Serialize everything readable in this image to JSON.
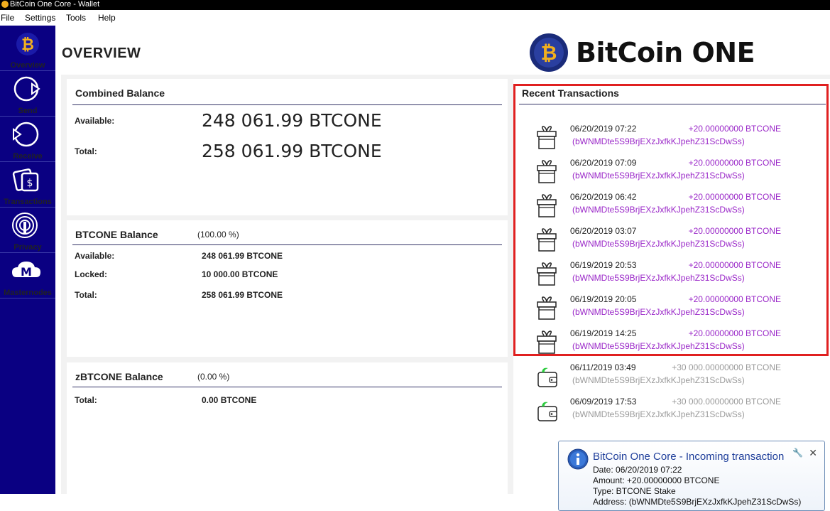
{
  "window": {
    "title": "BitCoin One Core - Wallet"
  },
  "menu": [
    "File",
    "Settings",
    "Tools",
    "Help"
  ],
  "nav": [
    {
      "label": "Overview",
      "icon": "bitcoin-one-logo-icon"
    },
    {
      "label": "Send",
      "icon": "send-icon"
    },
    {
      "label": "Receive",
      "icon": "receive-icon"
    },
    {
      "label": "Transactions",
      "icon": "transactions-icon"
    },
    {
      "label": "Privacy",
      "icon": "privacy-icon"
    },
    {
      "label": "Masternodes",
      "icon": "masternodes-icon"
    }
  ],
  "page": {
    "title": "OVERVIEW",
    "brand": "BitCoin ONE"
  },
  "combined": {
    "title": "Combined Balance",
    "available_label": "Available:",
    "available": "248 061.99 BTCONE",
    "total_label": "Total:",
    "total": "258 061.99 BTCONE"
  },
  "btcone": {
    "title": "BTCONE Balance",
    "pct": "(100.00 %)",
    "available_label": "Available:",
    "available": "248 061.99 BTCONE",
    "locked_label": "Locked:",
    "locked": "10 000.00 BTCONE",
    "total_label": "Total:",
    "total": "258 061.99 BTCONE"
  },
  "zbtcone": {
    "title": "zBTCONE Balance",
    "pct": "(0.00 %)",
    "total_label": "Total:",
    "total": "0.00 BTCONE"
  },
  "recent": {
    "title": "Recent Transactions",
    "items": [
      {
        "date": "06/20/2019 07:22",
        "amount": "+20.00000000 BTCONE",
        "address": "(bWNMDte5S9BrjEXzJxfkKJpehZ31ScDwSs)",
        "icon": "gift-icon"
      },
      {
        "date": "06/20/2019 07:09",
        "amount": "+20.00000000 BTCONE",
        "address": "(bWNMDte5S9BrjEXzJxfkKJpehZ31ScDwSs)",
        "icon": "gift-icon"
      },
      {
        "date": "06/20/2019 06:42",
        "amount": "+20.00000000 BTCONE",
        "address": "(bWNMDte5S9BrjEXzJxfkKJpehZ31ScDwSs)",
        "icon": "gift-icon"
      },
      {
        "date": "06/20/2019 03:07",
        "amount": "+20.00000000 BTCONE",
        "address": "(bWNMDte5S9BrjEXzJxfkKJpehZ31ScDwSs)",
        "icon": "gift-icon"
      },
      {
        "date": "06/19/2019 20:53",
        "amount": "+20.00000000 BTCONE",
        "address": "(bWNMDte5S9BrjEXzJxfkKJpehZ31ScDwSs)",
        "icon": "gift-icon"
      },
      {
        "date": "06/19/2019 20:05",
        "amount": "+20.00000000 BTCONE",
        "address": "(bWNMDte5S9BrjEXzJxfkKJpehZ31ScDwSs)",
        "icon": "gift-icon"
      },
      {
        "date": "06/19/2019 14:25",
        "amount": "+20.00000000 BTCONE",
        "address": "(bWNMDte5S9BrjEXzJxfkKJpehZ31ScDwSs)",
        "icon": "gift-icon"
      },
      {
        "date": "06/11/2019 03:49",
        "amount": "+30 000.00000000 BTCONE",
        "address": "(bWNMDte5S9BrjEXzJxfkKJpehZ31ScDwSs)",
        "icon": "wallet-icon"
      },
      {
        "date": "06/09/2019 17:53",
        "amount": "+30 000.00000000 BTCONE",
        "address": "(bWNMDte5S9BrjEXzJxfkKJpehZ31ScDwSs)",
        "icon": "wallet-icon"
      }
    ]
  },
  "toast": {
    "title": "BitCoin One Core - Incoming transaction",
    "date": "Date: 06/20/2019 07:22",
    "amount": "Amount: +20.00000000 BTCONE",
    "type": "Type: BTCONE Stake",
    "address": "Address:  (bWNMDte5S9BrjEXzJxfkKJpehZ31ScDwSs)",
    "close": "✕",
    "pin": "🔧"
  },
  "colors": {
    "sidebar": "#0a0082",
    "accent_purple": "#9a27c8",
    "highlight": "#e02020"
  }
}
